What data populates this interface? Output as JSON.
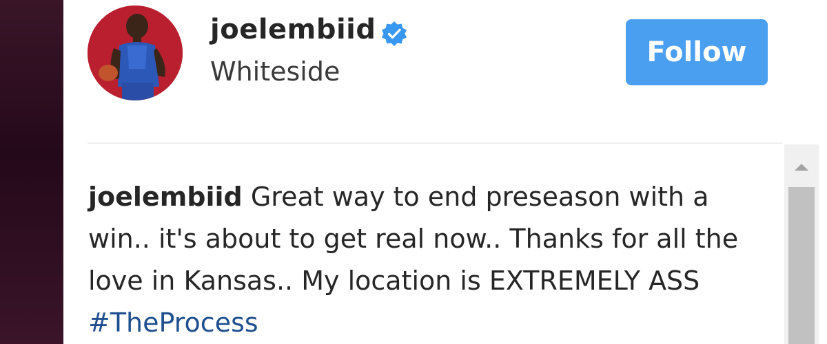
{
  "post": {
    "username": "joelembiid",
    "verified": true,
    "location": "Whiteside",
    "follow_label": "Follow"
  },
  "caption": {
    "author": "joelembiid",
    "text": " Great way to end preseason with a win.. it's about to get real now.. Thanks for all the love in Kansas.. My location is EXTREMELY ASS ",
    "hashtag": "#TheProcess"
  },
  "colors": {
    "follow_button": "#4a9ff0",
    "verified_badge": "#3897f0",
    "hashtag": "#1f4f8f",
    "avatar_background": "#b51e2c"
  },
  "icons": {
    "verified": "verified-badge-icon",
    "scroll_up": "scroll-up-arrow-icon"
  }
}
